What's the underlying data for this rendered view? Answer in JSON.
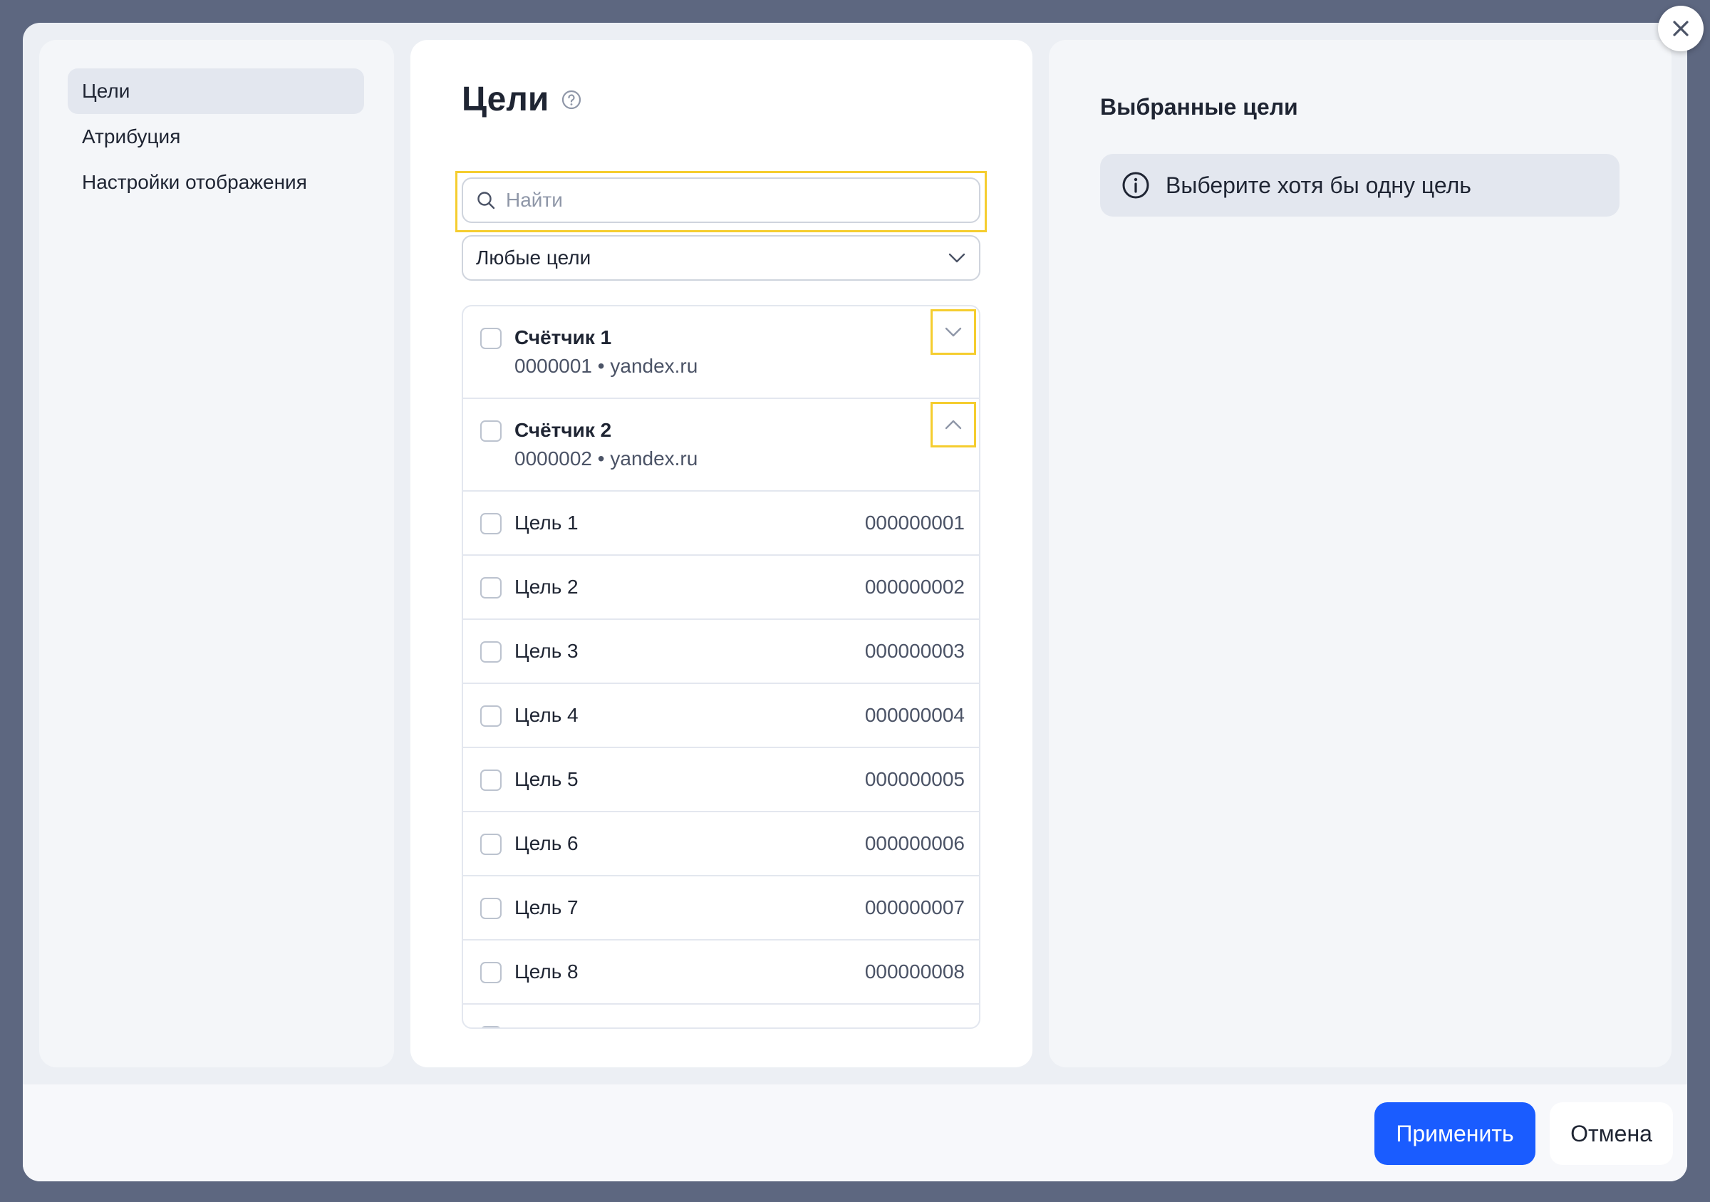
{
  "modal": {
    "close_icon": "close-icon"
  },
  "sidebar": {
    "items": [
      {
        "label": "Цели",
        "active": true
      },
      {
        "label": "Атрибуция",
        "active": false
      },
      {
        "label": "Настройки отображения",
        "active": false
      }
    ]
  },
  "goals_panel": {
    "title": "Цели",
    "search": {
      "placeholder": "Найти",
      "value": ""
    },
    "filter": {
      "selected": "Любые цели"
    },
    "counters": [
      {
        "name": "Счётчик 1",
        "subtitle": "0000001 • yandex.ru",
        "expanded": false
      },
      {
        "name": "Счётчик 2",
        "subtitle": "0000002 • yandex.ru",
        "expanded": true
      }
    ],
    "goals": [
      {
        "name": "Цель 1",
        "id": "000000001"
      },
      {
        "name": "Цель 2",
        "id": "000000002"
      },
      {
        "name": "Цель 3",
        "id": "000000003"
      },
      {
        "name": "Цель 4",
        "id": "000000004"
      },
      {
        "name": "Цель 5",
        "id": "000000005"
      },
      {
        "name": "Цель 6",
        "id": "000000006"
      },
      {
        "name": "Цель 7",
        "id": "000000007"
      },
      {
        "name": "Цель 8",
        "id": "000000008"
      }
    ]
  },
  "selected_panel": {
    "title": "Выбранные цели",
    "info_message": "Выберите хотя бы одну цель"
  },
  "footer": {
    "apply_label": "Применить",
    "cancel_label": "Отмена"
  },
  "colors": {
    "accent": "#1a5cff",
    "highlight": "#f5cd2f",
    "overlay": "#5d6780"
  }
}
